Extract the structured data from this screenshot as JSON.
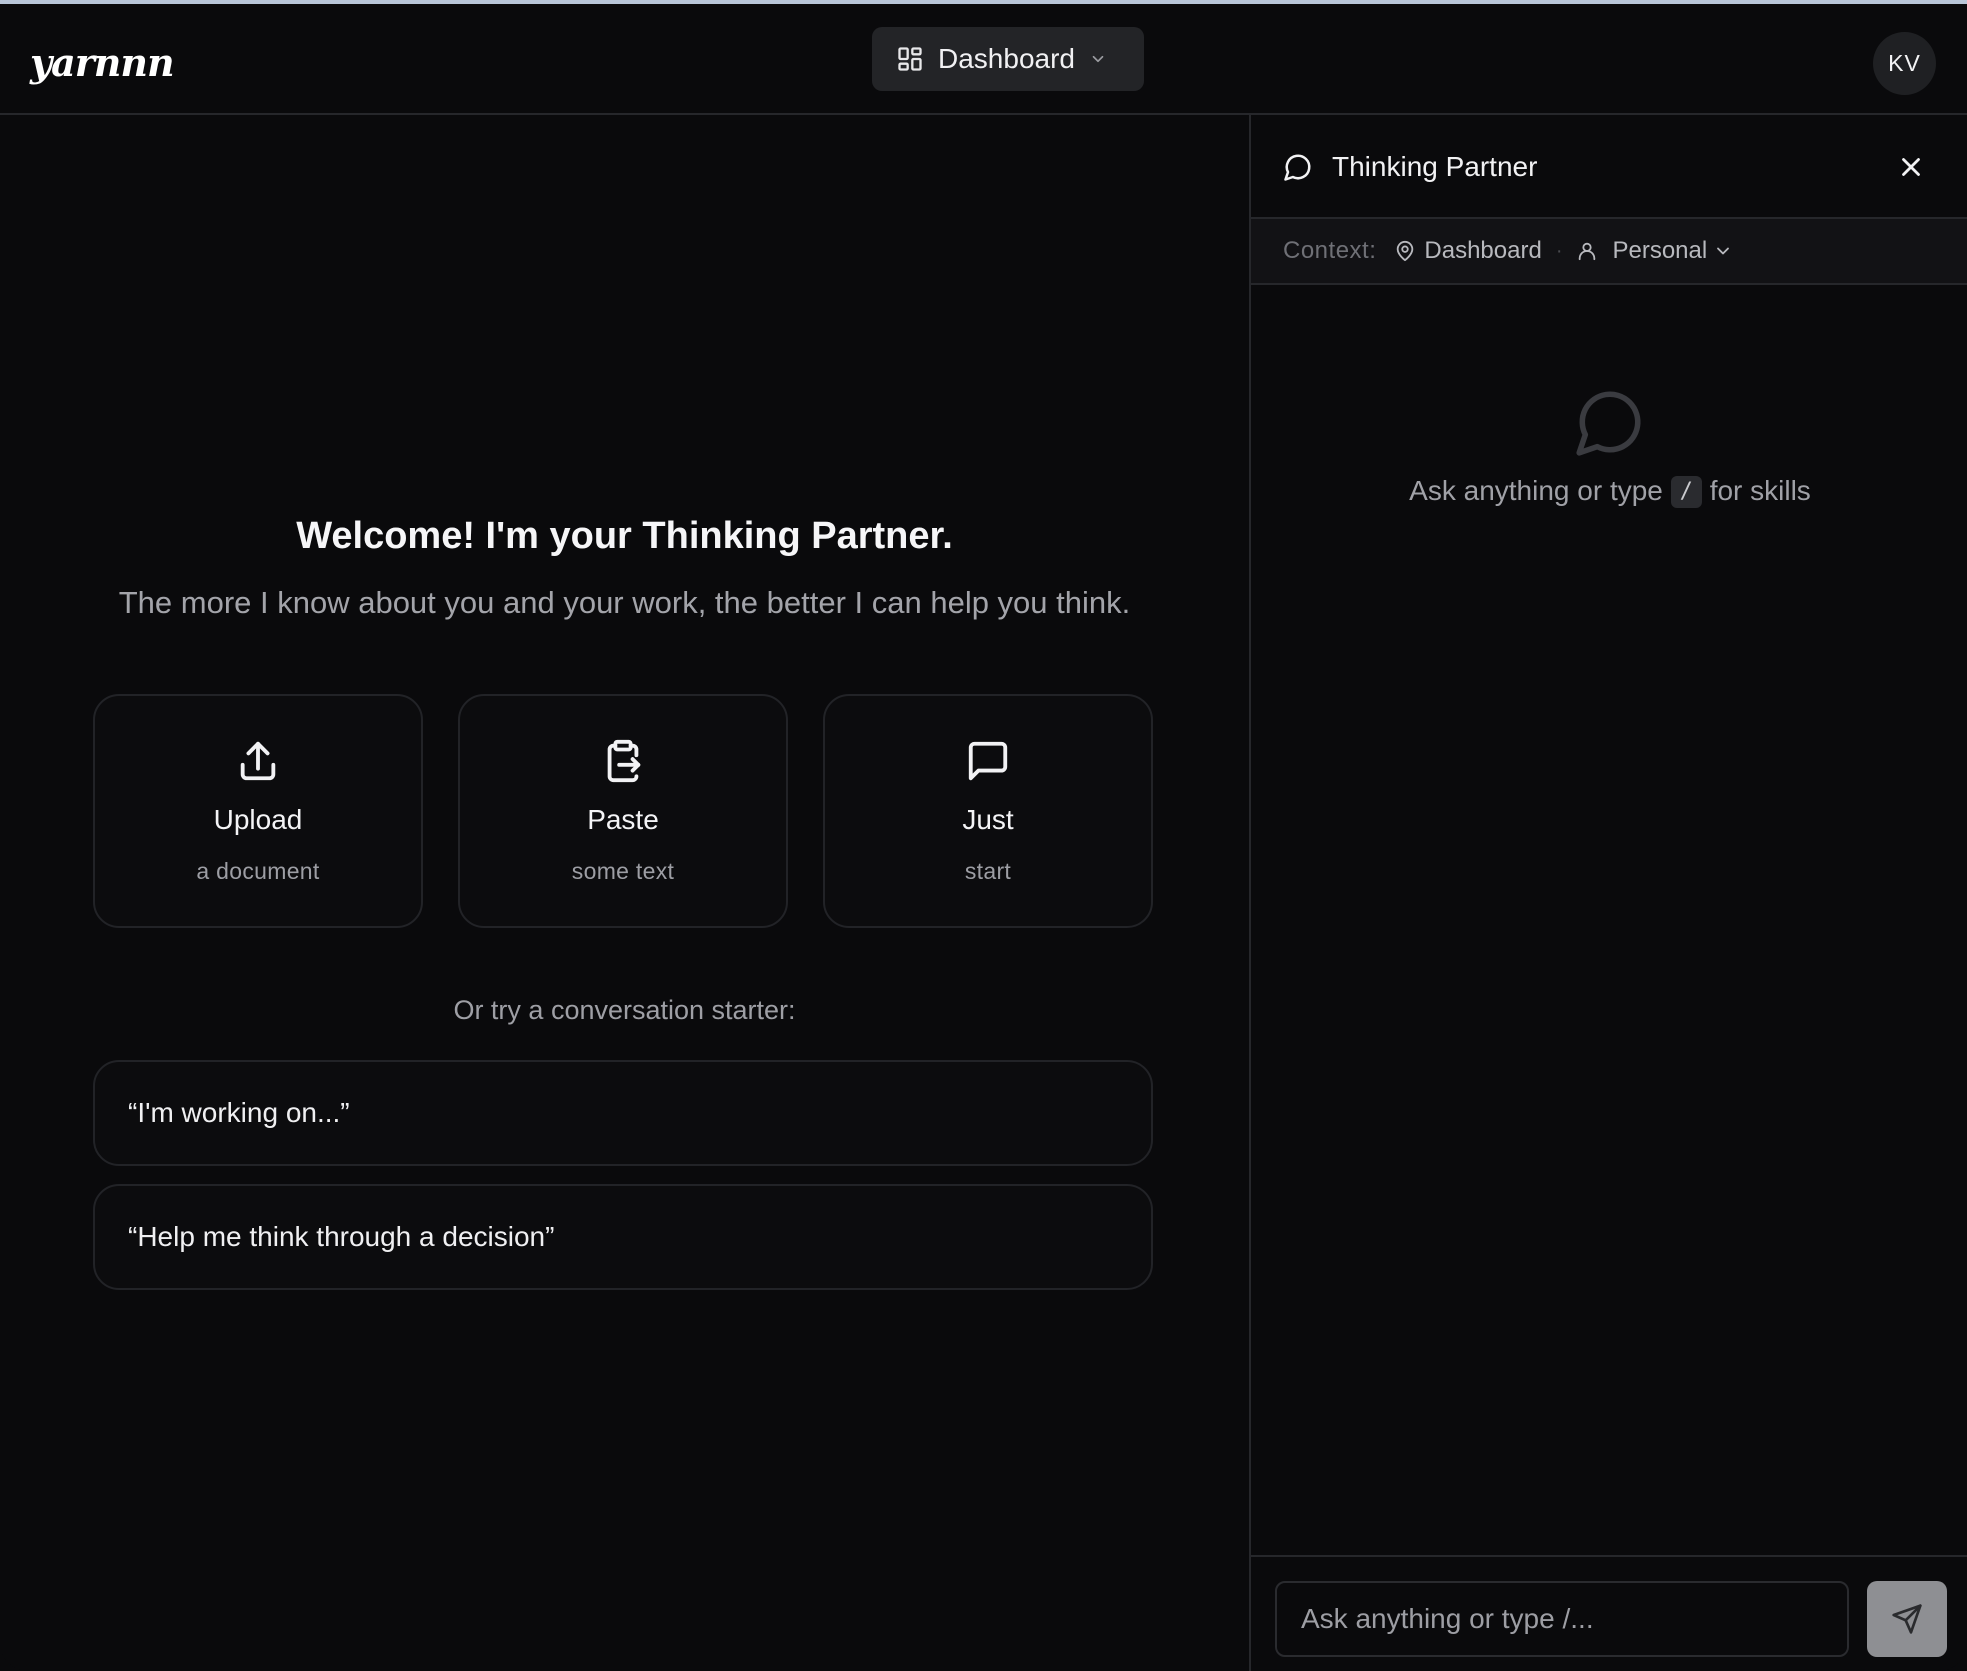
{
  "app": {
    "logo": "yarnnn"
  },
  "header": {
    "nav_label": "Dashboard",
    "avatar_initials": "KV"
  },
  "main": {
    "welcome": "Welcome! I'm your Thinking Partner.",
    "subtitle": "The more I know about you and your work, the better I can help you think.",
    "cards": [
      {
        "title": "Upload",
        "subtitle": "a document",
        "icon": "upload-icon"
      },
      {
        "title": "Paste",
        "subtitle": "some text",
        "icon": "clipboard-paste-icon"
      },
      {
        "title": "Just",
        "subtitle": "start",
        "icon": "message-square-icon"
      }
    ],
    "starter_label": "Or try a conversation starter:",
    "starters": [
      "“I'm working on...”",
      "“Help me think through a decision”"
    ]
  },
  "panel": {
    "title": "Thinking Partner",
    "context_label": "Context:",
    "context_location": "Dashboard",
    "context_scope": "Personal",
    "empty_prefix": "Ask anything or type",
    "empty_key": "/",
    "empty_suffix": "for skills",
    "input_placeholder": "Ask anything or type /..."
  }
}
